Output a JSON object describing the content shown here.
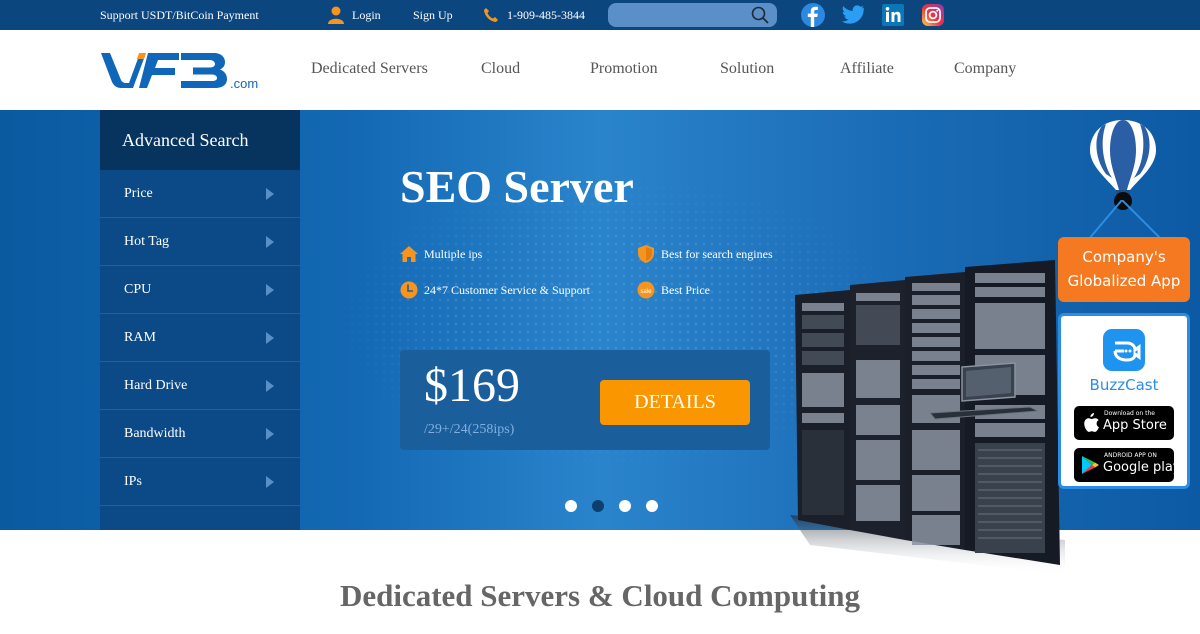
{
  "topbar": {
    "payment_notice": "Support USDT/BitCoin Payment",
    "login_label": "Login",
    "signup_label": "Sign Up",
    "phone": "1-909-485-3844",
    "search": {
      "value": "",
      "placeholder": ""
    },
    "social": [
      {
        "name": "facebook",
        "icon": "facebook-icon"
      },
      {
        "name": "twitter",
        "icon": "twitter-icon"
      },
      {
        "name": "linkedin",
        "icon": "linkedin-icon"
      },
      {
        "name": "instagram",
        "icon": "instagram-icon"
      }
    ],
    "accent_color": "#f7941d"
  },
  "header": {
    "logo_text": "UFB",
    "logo_suffix": ".com",
    "nav": [
      "Dedicated Servers",
      "Cloud",
      "Promotion",
      "Solution",
      "Affiliate",
      "Company"
    ]
  },
  "sidebar": {
    "title": "Advanced Search",
    "items": [
      "Price",
      "Hot Tag",
      "CPU",
      "RAM",
      "Hard Drive",
      "Bandwidth",
      "IPs"
    ]
  },
  "slide": {
    "title": "SEO Server",
    "features": [
      {
        "icon": "home-icon",
        "label": "Multiple ips"
      },
      {
        "icon": "shield-icon",
        "label": "Best for search engines"
      },
      {
        "icon": "clock-icon",
        "label": "24*7 Customer Service & Support"
      },
      {
        "icon": "sale-icon",
        "label": "Best Price"
      }
    ],
    "price": "$169",
    "price_note": "/29+/24(258ips)",
    "details_label": "DETAILS",
    "carousel": {
      "total": 4,
      "active_index": 1
    },
    "button_color": "#fa9600"
  },
  "app_widget": {
    "sign_line1": "Company's",
    "sign_line2": "Globalized App",
    "app_name": "BuzzCast",
    "apple_small": "Download on the",
    "apple_big": "App Store",
    "google_small": "ANDROID APP ON",
    "google_big": "Google play"
  },
  "section": {
    "title": "Dedicated Servers & Cloud Computing"
  }
}
